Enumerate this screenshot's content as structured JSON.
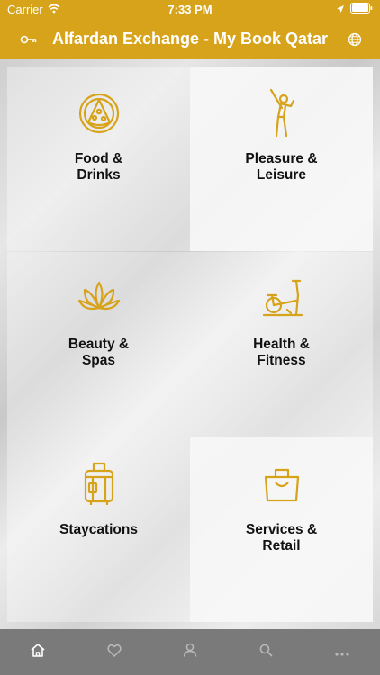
{
  "status_bar": {
    "carrier": "Carrier",
    "time": "7:33 PM",
    "icons": [
      "wifi-icon",
      "location-arrow-icon",
      "battery-icon"
    ]
  },
  "header": {
    "title": "Alfardan Exchange - My Book Qatar",
    "left_icon": "key-icon",
    "right_icon": "globe-icon",
    "background_color": "#d7a31a"
  },
  "categories": [
    {
      "label": "Food &\nDrinks",
      "icon": "pizza-icon"
    },
    {
      "label": "Pleasure &\nLeisure",
      "icon": "golfer-icon"
    },
    {
      "label": "Beauty &\nSpas",
      "icon": "lotus-icon"
    },
    {
      "label": "Health &\nFitness",
      "icon": "exercise-bike-icon"
    },
    {
      "label": "Staycations",
      "icon": "luggage-icon"
    },
    {
      "label": "Services &\nRetail",
      "icon": "shopping-bag-icon"
    }
  ],
  "tab_bar": {
    "items": [
      {
        "icon": "home-icon",
        "selected": true
      },
      {
        "icon": "heart-icon",
        "selected": false
      },
      {
        "icon": "user-icon",
        "selected": false
      },
      {
        "icon": "search-icon",
        "selected": false
      },
      {
        "icon": "more-icon",
        "selected": false
      }
    ]
  },
  "colors": {
    "accent": "#d7a31a",
    "tab_bar": "#7a7a7a"
  }
}
